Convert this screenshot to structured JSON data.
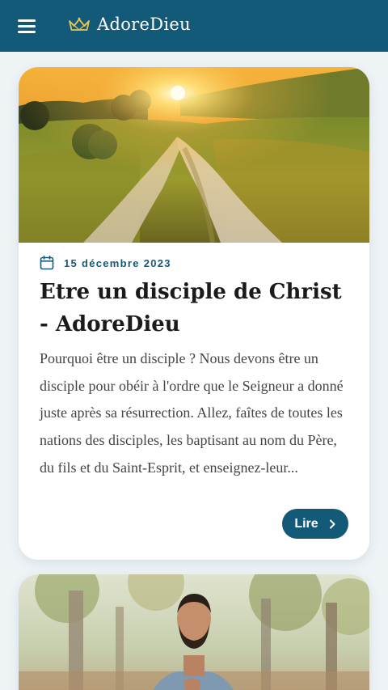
{
  "header": {
    "brand": "AdoreDieu",
    "menu_icon": "hamburger-menu-icon",
    "logo_icon": "crown-icon",
    "background": "#135a78"
  },
  "articles": [
    {
      "image": "sunset-country-path-photo",
      "date_icon": "calendar-icon",
      "date": "15 décembre 2023",
      "title": "Etre un disciple de Christ - AdoreDieu",
      "excerpt": "Pourquoi être un disciple ? Nous devons être un disciple pour obéir à l'ordre que le Seigneur a donné juste après sa résurrection. Allez, faîtes de toutes les nations des disciples, les baptisant au nom du Père, du fils et du Saint-Esprit, et enseignez-leur...",
      "button_label": "Lire",
      "button_icon": "chevron-right-icon"
    },
    {
      "image": "man-praying-in-park-photo"
    }
  ],
  "colors": {
    "accent": "#135a78",
    "page_background": "#eef3f6"
  }
}
